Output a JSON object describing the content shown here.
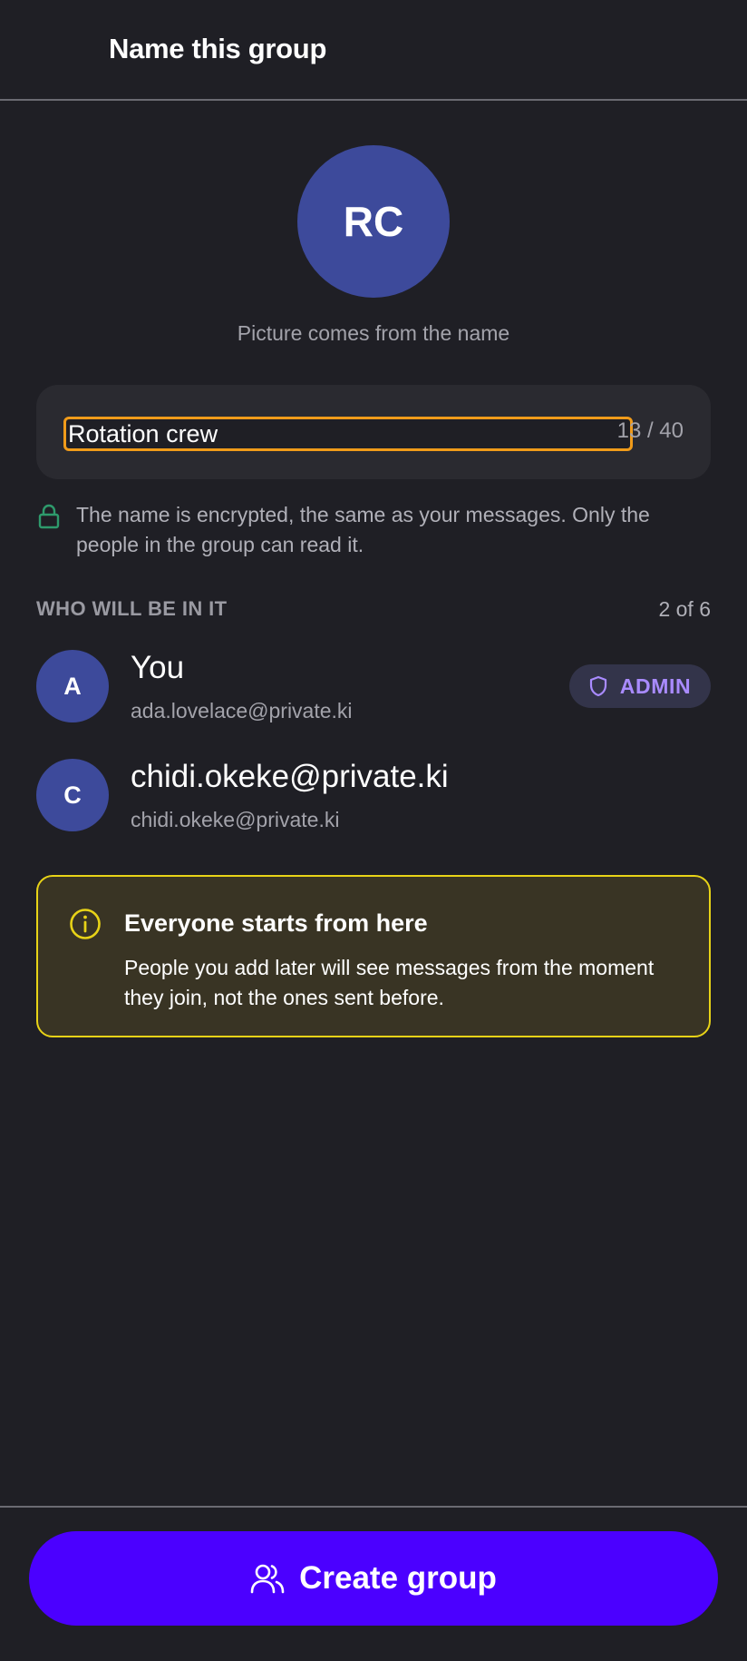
{
  "header": {
    "title": "Name this group"
  },
  "group": {
    "avatar_initials": "RC",
    "avatar_caption": "Picture comes from the name",
    "name_value": "Rotation crew",
    "char_count": "13 / 40"
  },
  "encryption_note": "The name is encrypted, the same as your messages. Only the people in the group can read it.",
  "members": {
    "label": "WHO WILL BE IN IT",
    "count": "2 of 6",
    "list": [
      {
        "initial": "A",
        "name": "You",
        "email": "ada.lovelace@private.ki",
        "badge": "ADMIN"
      },
      {
        "initial": "C",
        "name": "chidi.okeke@private.ki",
        "email": "chidi.okeke@private.ki"
      }
    ]
  },
  "info": {
    "title": "Everyone starts from here",
    "body": "People you add later will see messages from the moment they join, not the ones sent before."
  },
  "footer": {
    "create_label": "Create group"
  },
  "colors": {
    "background": "#1f1f25",
    "avatar": "#3d4a9b",
    "accent_button": "#4b00ff",
    "input_focus": "#f09b1a",
    "info_border": "#e8d317",
    "admin_text": "#a98bff",
    "lock_icon": "#2e9a6c"
  }
}
